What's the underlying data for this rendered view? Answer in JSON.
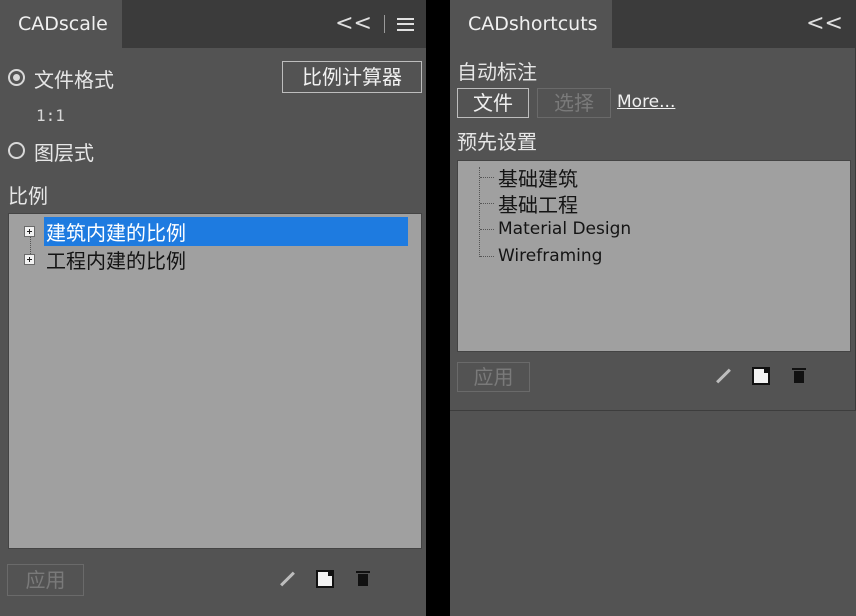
{
  "cadscale": {
    "tab_title": "CADscale",
    "collapse_glyph": "<<",
    "format_radio_label": "文件格式",
    "format_value": "1:1",
    "layer_radio_label": "图层式",
    "calculator_button": "比例计算器",
    "scale_label": "比例",
    "tree_items": [
      {
        "label": "建筑内建的比例",
        "selected": true
      },
      {
        "label": "工程内建的比例",
        "selected": false
      }
    ],
    "apply_button": "应用"
  },
  "cadshortcuts": {
    "tab_title": "CADshortcuts",
    "collapse_glyph": "<<",
    "auto_annotate_label": "自动标注",
    "file_button": "文件",
    "select_button": "选择",
    "more_link": "More...",
    "presets_label": "预先设置",
    "preset_items": [
      "基础建筑",
      "基础工程",
      "Material Design",
      "Wireframing"
    ],
    "apply_button": "应用"
  },
  "colors": {
    "panel_bg": "#535353",
    "tabbar_bg": "#3b3b3b",
    "list_bg": "#a0a0a0",
    "selection": "#1e7be0"
  }
}
